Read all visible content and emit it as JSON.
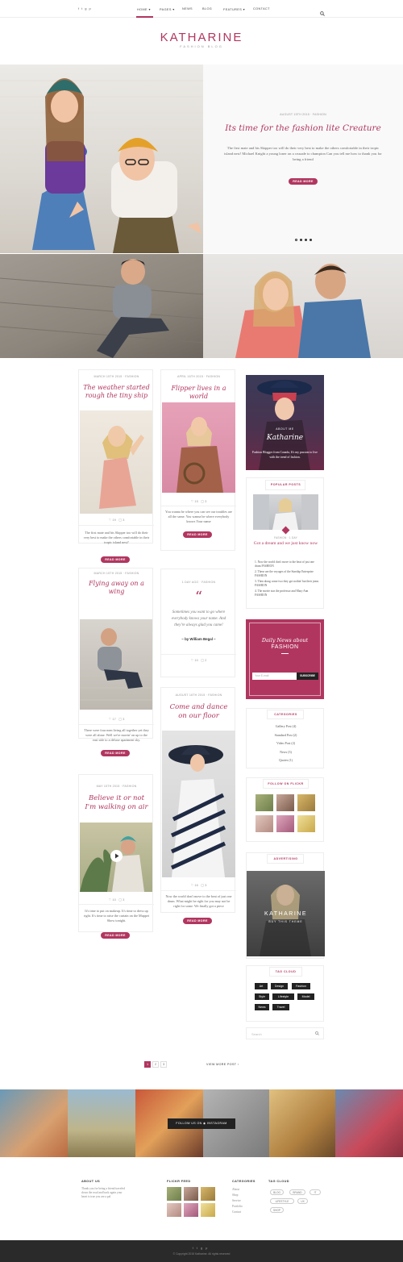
{
  "nav": {
    "social": [
      "f",
      "t",
      "g",
      "p"
    ],
    "items": [
      {
        "label": "HOME",
        "caret": "▾",
        "active": true
      },
      {
        "label": "PAGES",
        "caret": "▾",
        "active": false
      },
      {
        "label": "NEWS",
        "caret": "",
        "active": false
      },
      {
        "label": "BLOG",
        "caret": "",
        "active": false
      },
      {
        "label": "FEATURES",
        "caret": "▾",
        "active": false
      },
      {
        "label": "CONTACT",
        "caret": "",
        "active": false
      }
    ]
  },
  "brand": {
    "logo": "KATHARINE",
    "tagline": "FASHION BLOG"
  },
  "hero": {
    "meta": "AUGUST 15TH 2015 · FASHION",
    "title": "Its time for the fashion lite Creature",
    "text": "The first mate and his Skipper too will do their very best to make the others comfortable in their tropic island nest! Michael Knight a young loner on a crusade to champion Can you tell me how to thank you for being a friend",
    "button": "READ MORE",
    "slides": 4,
    "active_slide": 1
  },
  "posts": {
    "p1": {
      "meta": "MARCH 15TH 2015 · FASHION",
      "title": "The weather started rough the tiny ship",
      "likes": "19",
      "comments": "3",
      "excerpt": "The first mate and his Skipper too will do their very best to make the others comfortable in their tropic island nest?",
      "button": "READ MORE"
    },
    "p2": {
      "meta": "APRIL 16TH 2015 · FASHION",
      "title": "Flipper lives in a world",
      "likes": "15",
      "comments": "3",
      "excerpt": "You wanna be where you can see our troubles are all the same. You wanna be where everybody knows Your name",
      "button": "READ MORE"
    },
    "p3": {
      "meta": "MARCH 15TH 2015 · FASHION",
      "title": "Flying away on a wing",
      "likes": "17",
      "comments": "3",
      "excerpt": "There were four men living all together yet they were all alone. Well we're movin' on up to the east side to a deluxe apartment sky.",
      "button": "READ MORE"
    },
    "p4": {
      "meta": "1 DAY AGO · FASHION",
      "quote_mark": "“",
      "quote": "Sometimes you want to go where everybody knows your name. And they're always glad you came!",
      "author": "– by William Begal –",
      "likes": "10",
      "comments": "2"
    },
    "p5": {
      "meta": "MAY 15TH 2015 · FASHION",
      "title": "Believe it or not I'm walking on air",
      "likes": "10",
      "comments": "3",
      "excerpt": "It's time to put on makeup. It's time to dress up right. It's time to raise the curtain on the Muppet Show tonight.",
      "button": "READ MORE"
    },
    "p6": {
      "meta": "AUGUST 16TH 2015 · FASHION",
      "title": "Come and dance on our floor",
      "likes": "16",
      "comments": "3",
      "excerpt": "Now the world don't move to the beat of just one drum. What might be right for you may not be right for some. We finally got a piece",
      "button": "READ MORE"
    }
  },
  "sidebar": {
    "about": {
      "label": "ABOUT ME",
      "name": "Katharine",
      "text": "Fashion Blogger from Canada, It's my passion to live with the trend of fashion."
    },
    "popular": {
      "title": "POPULAR POSTS",
      "meta": "FASHION · 1 DAY",
      "post_title": "Got a dream and we just know now",
      "list": [
        "Now the world don't move to the beat of just one drum FASHION",
        "These are the voyages of the Starship Enterprise FASHION",
        "Then along come two they got nothin' but their jeans FASHION",
        "The movie star the professor and Mary Ann FASHION"
      ]
    },
    "newsletter": {
      "title": "Daily News about",
      "title2": "FASHION",
      "placeholder": "Your E-mail",
      "button": "SUBSCRIBE"
    },
    "categories": {
      "title": "CATEGORIES",
      "items": [
        "Gallery Post (4)",
        "Standard Post (2)",
        "Video Post (2)",
        "News (3)",
        "Quotes (1)"
      ]
    },
    "flickr": {
      "title": "FOLLOW ON FLICKR"
    },
    "ad": {
      "title": "ADVERTISING",
      "logo": "KATHARINE",
      "sub": "BUY THIS THEME"
    },
    "tags": {
      "title": "TAG CLOUD",
      "items": [
        "Art",
        "Design",
        "Fashion",
        "Style",
        "Lifestyle",
        "Model",
        "News",
        "Travel"
      ]
    },
    "search": {
      "placeholder": "Search"
    }
  },
  "pagination": {
    "pages": [
      "1",
      "2",
      "3"
    ],
    "active": "1",
    "view_more": "VIEW MORE POST"
  },
  "instagram": {
    "label": "FOLLOW US ON",
    "handle": "INSTAGRAM"
  },
  "footer": {
    "about": {
      "title": "ABOUT US",
      "text": "Thank you for being a friend traveled down the road and back again your heart is true you are a pal"
    },
    "flickr": {
      "title": "FLICKR FEED"
    },
    "categories": {
      "title": "CATEGORIES",
      "items": [
        "About",
        "Shop",
        "Service",
        "Portfolio",
        "Contact"
      ]
    },
    "tags": {
      "title": "TAG CLOUD",
      "items": [
        "BLOG",
        "BRAND",
        "IT",
        "LIFESTYLE",
        "UX",
        "SHOP"
      ]
    },
    "social": [
      "f",
      "t",
      "g",
      "p"
    ],
    "copyright": "© Copyright 2015 Katharine. All rights reserved"
  },
  "colors": {
    "accent": "#b1365f",
    "dark": "#222222",
    "footer_bar": "#2a2a2a"
  }
}
